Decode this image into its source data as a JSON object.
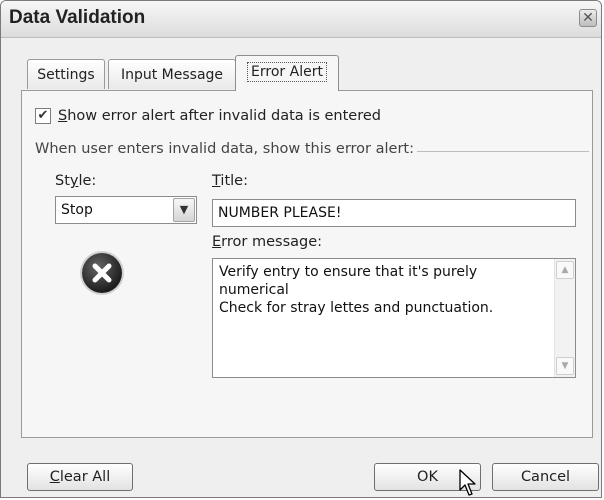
{
  "window": {
    "title": "Data Validation",
    "close_icon": "close-icon"
  },
  "tabs": [
    {
      "label": "Settings",
      "active": false
    },
    {
      "label": "Input Message",
      "active": false
    },
    {
      "label": "Error Alert",
      "active": true
    }
  ],
  "error_alert": {
    "show_alert": {
      "checked": true,
      "label_rest": "how error alert after invalid data is entered",
      "hotkey": "S"
    },
    "section_label": "When user enters invalid data, show this error alert:",
    "style": {
      "label_pre": "St",
      "hotkey": "y",
      "label_post": "le:",
      "value": "Stop",
      "icon": "stop-error-icon"
    },
    "title": {
      "hotkey": "T",
      "label_rest": "itle:",
      "value": "NUMBER PLEASE!"
    },
    "message": {
      "hotkey": "E",
      "label_rest": "rror message:",
      "lines": [
        "Verify entry to ensure that it's purely",
        "numerical",
        "Check for stray lettes and punctuation."
      ]
    }
  },
  "buttons": {
    "clear_all": {
      "hotkey": "C",
      "rest": "lear All"
    },
    "ok": "OK",
    "cancel": "Cancel"
  },
  "icons": {
    "checkmark": "checkmark-icon",
    "dropdown": "chevron-down-icon",
    "scroll_up": "scroll-up-icon",
    "scroll_down": "scroll-down-icon",
    "cursor": "mouse-cursor-icon"
  }
}
